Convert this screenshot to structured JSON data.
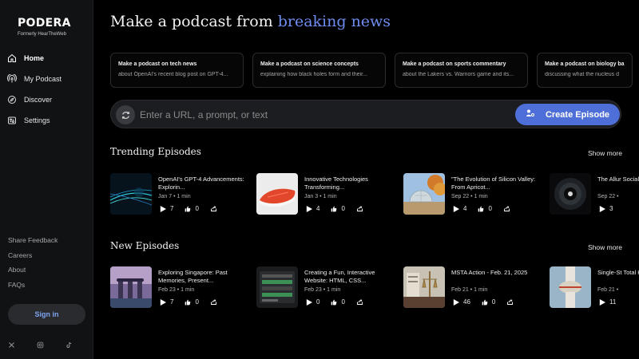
{
  "brand": {
    "name": "PODERA",
    "formerly": "Formerly HearTheWeb"
  },
  "nav": [
    {
      "label": "Home",
      "icon": "home-icon",
      "active": true
    },
    {
      "label": "My Podcast",
      "icon": "podcast-icon",
      "active": false
    },
    {
      "label": "Discover",
      "icon": "compass-icon",
      "active": false
    },
    {
      "label": "Settings",
      "icon": "settings-icon",
      "active": false
    }
  ],
  "footer_links": [
    "Share Feedback",
    "Careers",
    "About",
    "FAQs"
  ],
  "signin_label": "Sign in",
  "socials": [
    "x-icon",
    "instagram-icon",
    "tiktok-icon"
  ],
  "headline": {
    "prefix": "Make a podcast from ",
    "accent": "breaking news",
    "accent_color": "#6f8df0"
  },
  "suggestions": [
    {
      "title": "Make a podcast on tech news",
      "desc": "about OpenAI's recent blog post on GPT-4..."
    },
    {
      "title": "Make a podcast on science concepts",
      "desc": "explaining how black holes form and their..."
    },
    {
      "title": "Make a podcast on sports commentary",
      "desc": "about the Lakers vs. Warriors game and its..."
    },
    {
      "title": "Make a podcast on biology ba",
      "desc": "discussing what the nucleus d"
    }
  ],
  "prompt": {
    "placeholder": "Enter a URL, a prompt, or text",
    "create_label": "Create Episode",
    "button_color": "#4f6fd8"
  },
  "trending": {
    "title": "Trending Episodes",
    "show_more": "Show more",
    "episodes": [
      {
        "title": "OpenAI's GPT-4 Advancements: Explorin...",
        "meta": "Jan 7 • 1 min",
        "plays": "7",
        "likes": "0"
      },
      {
        "title": "Innovative Technologies Transforming...",
        "meta": "Jan 3 • 1 min",
        "plays": "4",
        "likes": "0"
      },
      {
        "title": "\"The Evolution of Silicon Valley: From Apricot...",
        "meta": "Sep 22 • 1 min",
        "plays": "4",
        "likes": "0"
      },
      {
        "title": "The Allur Social M",
        "meta": "Sep 22 •",
        "plays": "3",
        "likes": ""
      }
    ]
  },
  "new": {
    "title": "New Episodes",
    "show_more": "Show more",
    "episodes": [
      {
        "title": "Exploring Singapore: Past Memories, Present...",
        "meta": "Feb 23 • 1 min",
        "plays": "7",
        "likes": "0"
      },
      {
        "title": "Creating a Fun, Interactive Website: HTML, CSS...",
        "meta": "Feb 23 • 1 min",
        "plays": "0",
        "likes": "0"
      },
      {
        "title": "MSTA Action - Feb. 21, 2025",
        "meta": "Feb 21 • 1 min",
        "plays": "46",
        "likes": "0"
      },
      {
        "title": "Single-St Total Kne",
        "meta": "Feb 21 •",
        "plays": "11",
        "likes": ""
      }
    ]
  }
}
